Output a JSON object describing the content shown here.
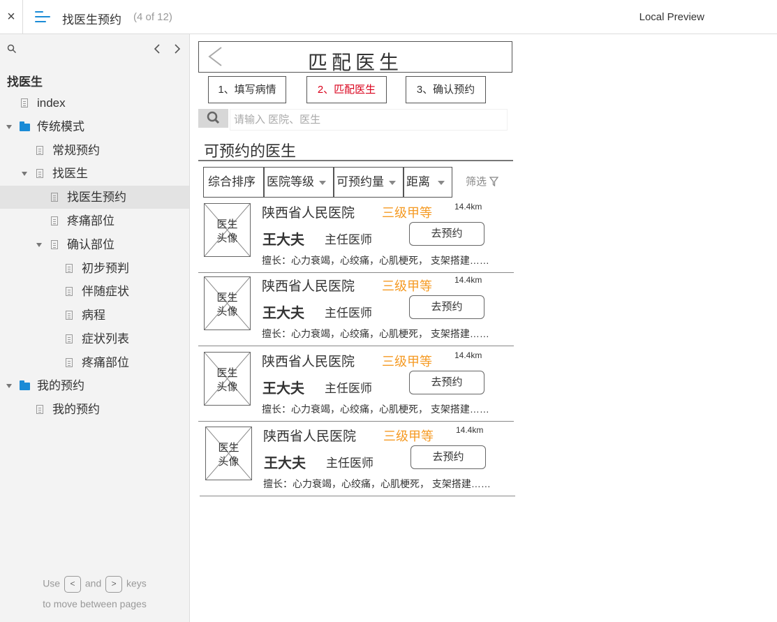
{
  "topbar": {
    "close_glyph": "×",
    "title": "找医生预约",
    "count": "(4 of 12)",
    "preview_label": "Local Preview"
  },
  "sidebar": {
    "project_title": "找医生",
    "items": [
      {
        "label": "index"
      },
      {
        "label": "传统模式"
      },
      {
        "label": "常规预约"
      },
      {
        "label": "找医生"
      },
      {
        "label": "找医生预约"
      },
      {
        "label": "疼痛部位"
      },
      {
        "label": "确认部位"
      },
      {
        "label": "初步预判"
      },
      {
        "label": "伴随症状"
      },
      {
        "label": "病程"
      },
      {
        "label": "症状列表"
      },
      {
        "label": "疼痛部位"
      },
      {
        "label": "我的预约"
      },
      {
        "label": "我的预约"
      }
    ],
    "hint_use": "Use",
    "hint_key_left": "<",
    "hint_and": "and",
    "hint_key_right": ">",
    "hint_keys": "keys",
    "hint_line2": "to move between pages"
  },
  "page": {
    "header_title": "匹配医生",
    "steps": [
      "1、填写病情",
      "2、匹配医生",
      "3、确认预约"
    ],
    "search_placeholder": "请输入 医院、医生",
    "section_title": "可预约的医生",
    "filters": [
      "综合排序",
      "医院等级",
      "可预约量",
      "距离"
    ],
    "filter_button": "筛选",
    "accent_red": "#d9001b",
    "accent_orange": "#f59a23"
  },
  "doctors": [
    {
      "avatar": "医生头像",
      "hospital": "陕西省人民医院",
      "grade": "三级甲等",
      "distance": "14.4km",
      "name": "王大夫",
      "title": "主任医师",
      "book": "去预约",
      "expertise": "擅长：心力衰竭，心绞痛，心肌梗死， 支架搭建……"
    },
    {
      "avatar": "医生头像",
      "hospital": "陕西省人民医院",
      "grade": "三级甲等",
      "distance": "14.4km",
      "name": "王大夫",
      "title": "主任医师",
      "book": "去预约",
      "expertise": "擅长：心力衰竭，心绞痛，心肌梗死， 支架搭建……"
    },
    {
      "avatar": "医生头像",
      "hospital": "陕西省人民医院",
      "grade": "三级甲等",
      "distance": "14.4km",
      "name": "王大夫",
      "title": "主任医师",
      "book": "去预约",
      "expertise": "擅长：心力衰竭，心绞痛，心肌梗死， 支架搭建……"
    },
    {
      "avatar": "医生头像",
      "hospital": "陕西省人民医院",
      "grade": "三级甲等",
      "distance": "14.4km",
      "name": "王大夫",
      "title": "主任医师",
      "book": "去预约",
      "expertise": "擅长：心力衰竭，心绞痛，心肌梗死， 支架搭建……"
    }
  ]
}
